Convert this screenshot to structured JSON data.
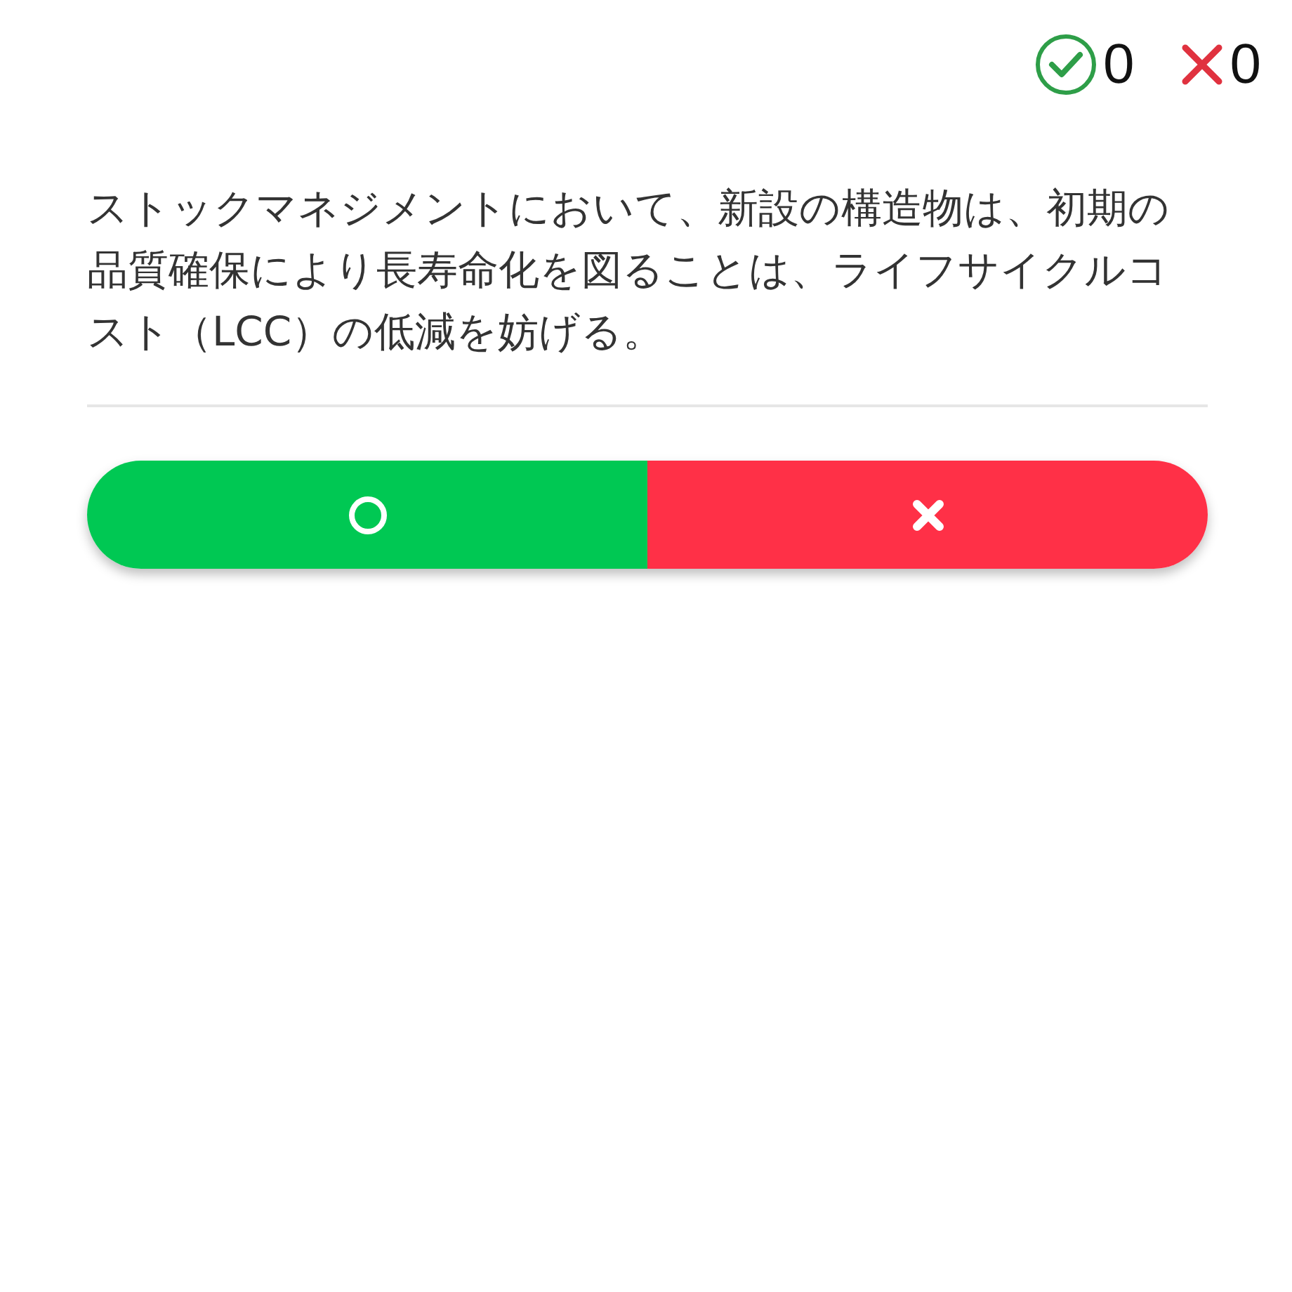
{
  "score": {
    "correct": "0",
    "wrong": "0"
  },
  "question": "ストックマネジメントにおいて、新設の構造物は、初期の品質確保により長寿命化を図ることは、ライフサイクルコスト（LCC）の低減を妨げる。",
  "answers": [
    {
      "kind": "maru"
    },
    {
      "kind": "batsu"
    }
  ]
}
